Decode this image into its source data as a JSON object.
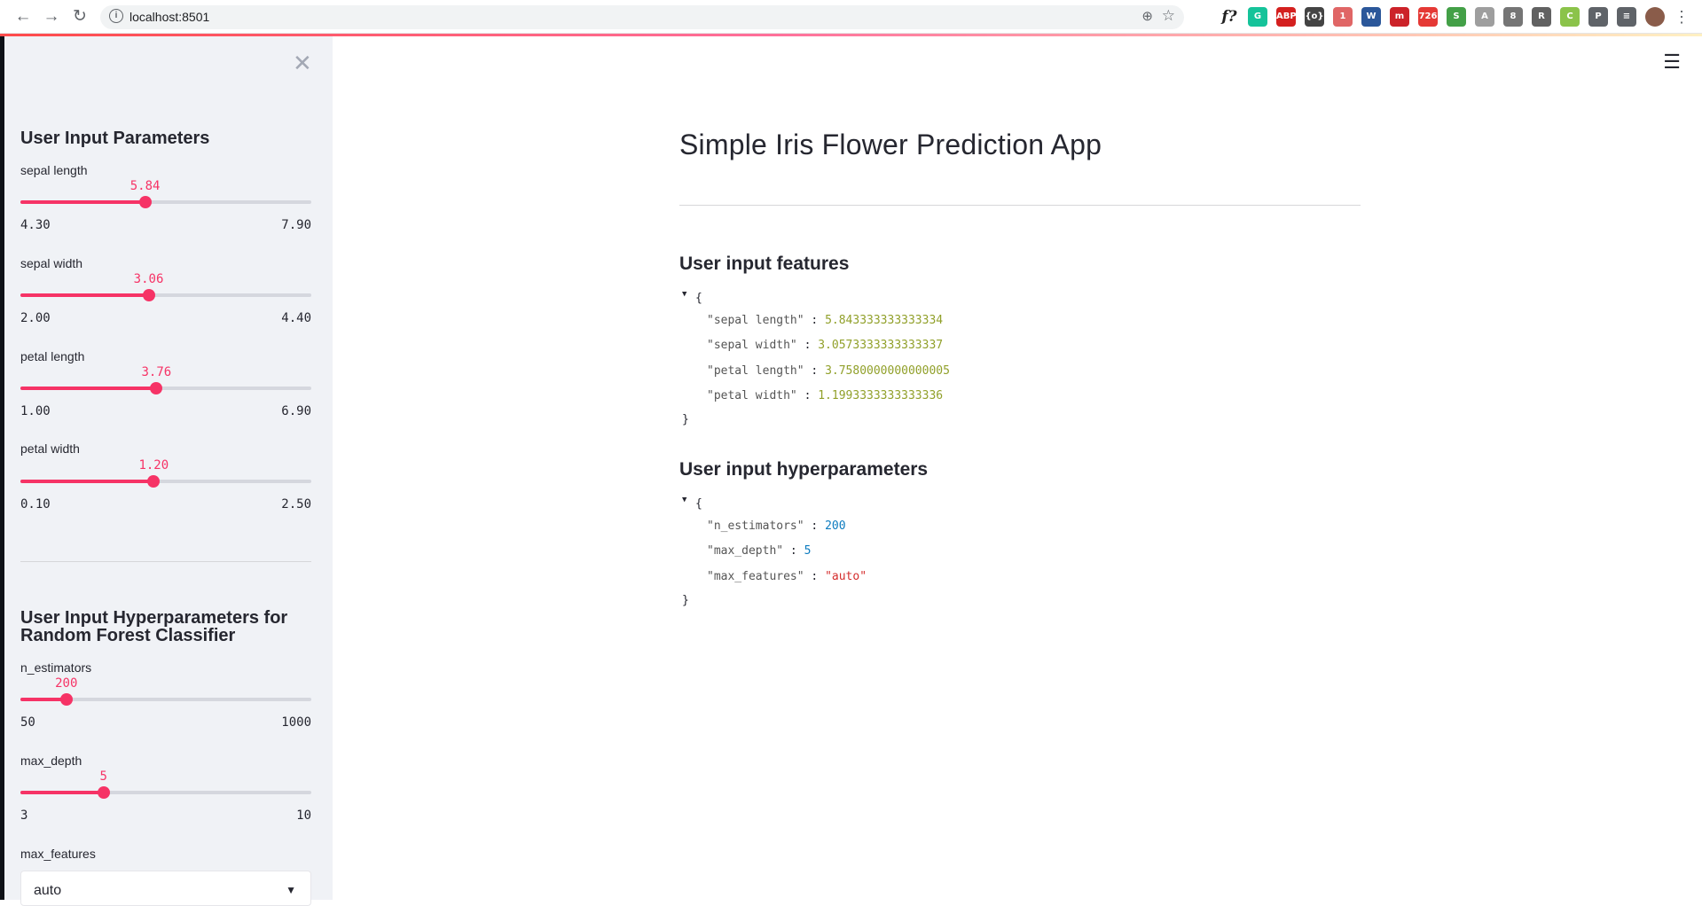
{
  "browser": {
    "url": "localhost:8501",
    "extensions": [
      {
        "icon": "font-identifier-icon",
        "label": "f?",
        "color": "#222222"
      },
      {
        "icon": "grammarly-icon",
        "label": "G",
        "color": "#15c39a"
      },
      {
        "icon": "adblock-icon",
        "label": "ABP",
        "color": "#d4201f"
      },
      {
        "icon": "json-viewer-icon",
        "label": "{o}",
        "color": "#444444"
      },
      {
        "icon": "ext-badge-icon",
        "label": "1",
        "color": "#e06666"
      },
      {
        "icon": "word-icon",
        "label": "W",
        "color": "#2b579a"
      },
      {
        "icon": "mailtrack-icon",
        "label": "m",
        "color": "#cc2229"
      },
      {
        "icon": "counter-icon",
        "label": "726",
        "color": "#e53935"
      },
      {
        "icon": "green-circle-icon",
        "label": "S",
        "color": "#43a047"
      },
      {
        "icon": "translate-icon",
        "label": "A",
        "color": "#9e9e9e"
      },
      {
        "icon": "eight-icon",
        "label": "8",
        "color": "#757575"
      },
      {
        "icon": "robot-icon",
        "label": "R",
        "color": "#616161"
      },
      {
        "icon": "color-icon",
        "label": "C",
        "color": "#8bc34a"
      },
      {
        "icon": "puzzle-icon",
        "label": "P",
        "color": "#5f6368"
      },
      {
        "icon": "playlist-icon",
        "label": "≡",
        "color": "#5f6368"
      }
    ]
  },
  "sidebar": {
    "heading1": "User Input Parameters",
    "heading2": "User Input Hyperparameters for Random Forest Classifier",
    "sliders": [
      {
        "label": "sepal length",
        "value": "5.84",
        "min": "4.30",
        "max": "7.90",
        "fraction": 0.4287
      },
      {
        "label": "sepal width",
        "value": "3.06",
        "min": "2.00",
        "max": "4.40",
        "fraction": 0.4406
      },
      {
        "label": "petal length",
        "value": "3.76",
        "min": "1.00",
        "max": "6.90",
        "fraction": 0.4675
      },
      {
        "label": "petal width",
        "value": "1.20",
        "min": "0.10",
        "max": "2.50",
        "fraction": 0.4583
      },
      {
        "label": "n_estimators",
        "value": "200",
        "min": "50",
        "max": "1000",
        "fraction": 0.1579
      },
      {
        "label": "max_depth",
        "value": "5",
        "min": "3",
        "max": "10",
        "fraction": 0.2857
      }
    ],
    "select": {
      "label": "max_features",
      "value": "auto"
    }
  },
  "main": {
    "title": "Simple Iris Flower Prediction App",
    "features_heading": "User input features",
    "features": [
      {
        "key": "\"sepal length\"",
        "value": "5.843333333333334"
      },
      {
        "key": "\"sepal width\"",
        "value": "3.0573333333333337"
      },
      {
        "key": "\"petal length\"",
        "value": "3.7580000000000005"
      },
      {
        "key": "\"petal width\"",
        "value": "1.1993333333333336"
      }
    ],
    "hyper_heading": "User input hyperparameters",
    "hyperparameters": [
      {
        "key": "\"n_estimators\"",
        "value": "200"
      },
      {
        "key": "\"max_depth\"",
        "value": "5"
      },
      {
        "key": "\"max_features\"",
        "value": "\"auto\""
      }
    ]
  }
}
